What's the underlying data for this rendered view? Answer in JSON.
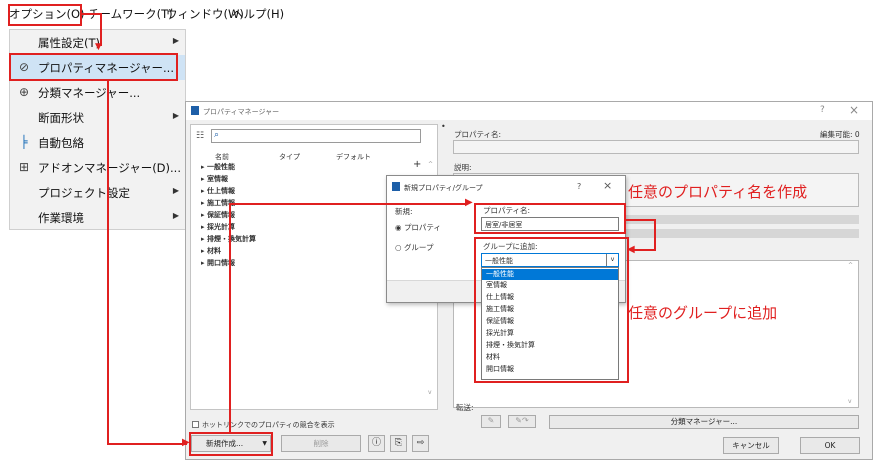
{
  "menubar": {
    "items": [
      "オプション(O)",
      "チームワーク(T)",
      "ウィンドウ(W)",
      "ヘルプ(H)"
    ]
  },
  "dropdown": {
    "items": [
      {
        "label": "属性設定(T)",
        "icon": "none",
        "submenu": true
      },
      {
        "label": "プロパティマネージャー...",
        "icon": "tag-icon",
        "submenu": false
      },
      {
        "label": "分類マネージャー...",
        "icon": "classification-icon",
        "submenu": false
      },
      {
        "label": "断面形状",
        "icon": "none",
        "submenu": true
      },
      {
        "label": "自動包絡",
        "icon": "junction-icon",
        "submenu": false
      },
      {
        "label": "アドオンマネージャー(D)...",
        "icon": "addon-icon",
        "submenu": false
      },
      {
        "label": "プロジェクト設定",
        "icon": "none",
        "submenu": true
      },
      {
        "label": "作業環境",
        "icon": "none",
        "submenu": true
      }
    ]
  },
  "property_manager": {
    "title": "プロパティマネージャー",
    "help": "?",
    "close": "×",
    "columns": [
      "名前",
      "タイプ",
      "デフォルト"
    ],
    "groups": [
      "一般性能",
      "室情報",
      "仕上情報",
      "施工情報",
      "保証情報",
      "採光計算",
      "排煙・換気計算",
      "材料",
      "開口情報"
    ],
    "add_symbol": "+",
    "checkbox_label": "ホットリンクでのプロパティの競合を表示",
    "new_button": "新規作成...",
    "delete_button": "削除",
    "property_name_label": "プロパティ名:",
    "editable_label": "編集可能: 0",
    "description_label": "説明:",
    "transfer_label": "転送:",
    "classification_button": "分類マネージャー...",
    "cancel_button": "キャンセル",
    "ok_button": "OK"
  },
  "new_dialog": {
    "title": "新規プロパティ/グループ",
    "help": "?",
    "close": "×",
    "new_label": "新規:",
    "radio_property": "プロパティ",
    "radio_group": "グループ",
    "property_name_label": "プロパティ名:",
    "property_name_value": "居室/非居室",
    "add_to_group_label": "グループに追加:",
    "selected_group": "一般性能",
    "group_options": [
      "一般性能",
      "室情報",
      "仕上情報",
      "施工情報",
      "保証情報",
      "採光計算",
      "排煙・換気計算",
      "材料",
      "開口情報"
    ]
  },
  "annotations": {
    "name_note": "任意のプロパティ名を作成",
    "group_note": "任意のグループに追加"
  },
  "colors": {
    "annotation": "#e02020",
    "selection": "#0078d7",
    "menu_highlight": "#cfe3f5"
  }
}
